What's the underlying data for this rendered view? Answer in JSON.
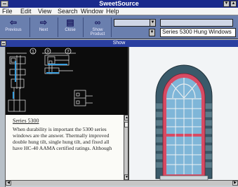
{
  "app": {
    "title": "SweetSource"
  },
  "menu": {
    "items": [
      "File",
      "Edit",
      "View",
      "Search",
      "Window",
      "Help"
    ]
  },
  "toolbar": {
    "buttons": [
      {
        "label": "Previous",
        "icon": "left-arrow-icon"
      },
      {
        "label": "Next",
        "icon": "right-arrow-icon"
      },
      {
        "label": "Close",
        "icon": "book-icon"
      },
      {
        "label": "Show Product",
        "icon": "binoculars-icon"
      }
    ],
    "combo_left_value": "",
    "combo_right_value": "",
    "product_selector": "Series 5300 Hung Windows"
  },
  "show_window": {
    "title": "Show"
  },
  "detail_drawing": {
    "callouts": [
      "1",
      "3",
      "2"
    ]
  },
  "text": {
    "heading": "Series 5300",
    "body": "When durability is important the 5300 series windows are the answer. Thermally improved double hung tilt, single hung tilt, and fixed all have HC-40 AAMA certified ratings. Although"
  },
  "colors": {
    "title_bar": "#1a2a8c",
    "toolbar": "#6a7fae",
    "window_frame": "#d84a63",
    "glass": "#7fb6d8",
    "stone": "#3a5a6a"
  }
}
